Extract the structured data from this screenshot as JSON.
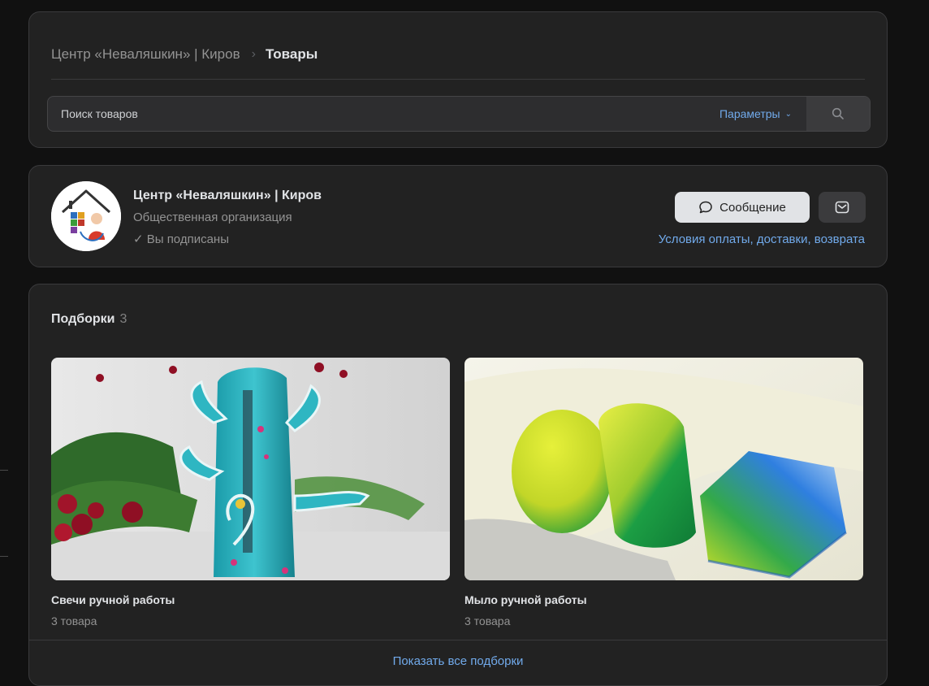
{
  "breadcrumb": {
    "community": "Центр «Неваляшкин» | Киров",
    "separator": "›",
    "current": "Товары"
  },
  "search": {
    "placeholder": "Поиск товаров",
    "params_label": "Параметры",
    "button_icon": "search-icon"
  },
  "profile": {
    "name": "Центр «Неваляшкин» | Киров",
    "type": "Общественная организация",
    "subscribed": "✓ Вы подписаны",
    "message_button": "Сообщение",
    "mail_icon": "mail-icon",
    "terms_link": "Условия оплаты, доставки, возврата"
  },
  "collections": {
    "title": "Подборки",
    "count": "3",
    "items": [
      {
        "name": "Свечи ручной работы",
        "count": "3 товара"
      },
      {
        "name": "Мыло ручной работы",
        "count": "3 товара"
      }
    ],
    "show_all": "Показать все подборки"
  },
  "colors": {
    "background": "#111111",
    "card": "#222222",
    "accent_link": "#71aaeb",
    "text_primary": "#e1e3e6",
    "text_secondary": "#939393"
  }
}
